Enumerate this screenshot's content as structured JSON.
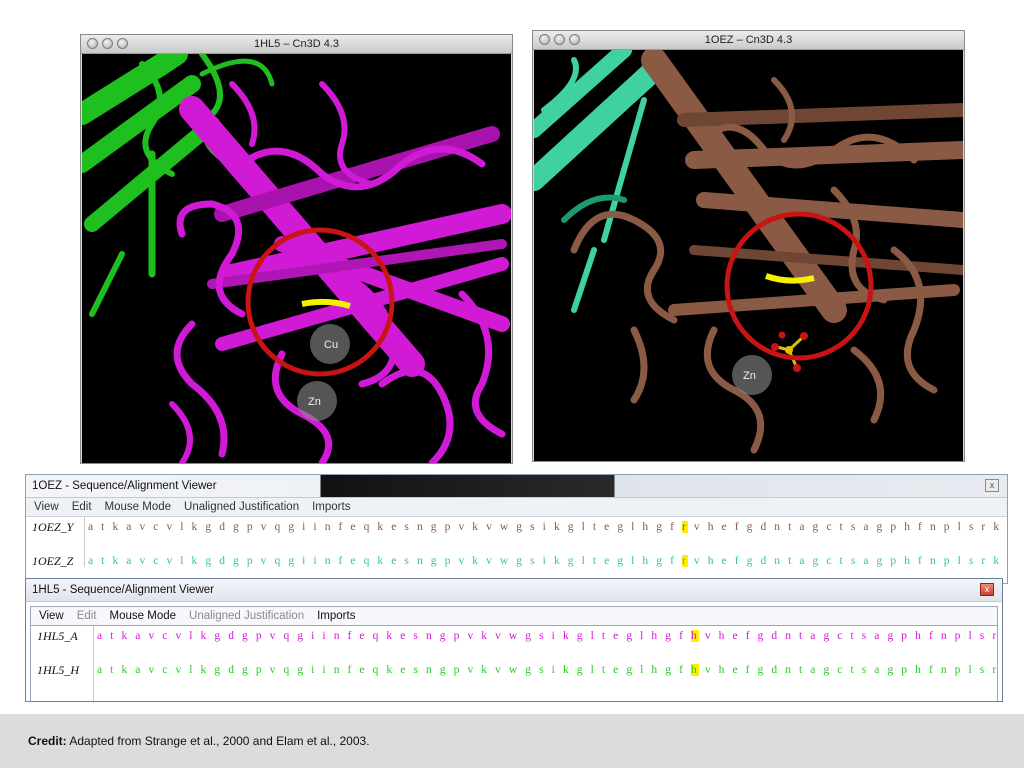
{
  "window_left": {
    "title": "1HL5 – Cn3D 4.3",
    "ion_labels": [
      "Cu",
      "Zn"
    ]
  },
  "window_right": {
    "title": "1OEZ – Cn3D 4.3",
    "ion_labels": [
      "Zn"
    ]
  },
  "viewer_back": {
    "title": "1OEZ - Sequence/Alignment Viewer",
    "menu": [
      "View",
      "Edit",
      "Mouse Mode",
      "Unaligned Justification",
      "Imports"
    ],
    "rows": [
      {
        "label": "1OEZ_Y",
        "pre": "a t k a v c v l k g d g p v q g i i n f e q k e s n g p v k v w g s i k g l t e g l h g f ",
        "hit": "r",
        "post": " v h e f g d n t a g c t s a g p h f n p l s r k h g g p k d e e r h v g d l"
      },
      {
        "label": "1OEZ_Z",
        "pre": "a t k a v c v l k g d g p v q g i i n f e q k e s n g p v k v w g s i k g l t e g l h g f ",
        "hit": "r",
        "post": " v h e f g d n t a g c t s a g p h f n p l s r k h g g p k d e e r h v g d l"
      }
    ]
  },
  "viewer_front": {
    "title": "1HL5 - Sequence/Alignment Viewer",
    "menu": [
      "View",
      "Edit",
      "Mouse Mode",
      "Unaligned Justification",
      "Imports"
    ],
    "rows": [
      {
        "label": "1HL5_A",
        "pre": "a t k a v c v l k g d g p v q g i i n f e q k e s n g p v k v w g s i k g l t e g l h g f ",
        "hit": "h",
        "post": " v h e f g d n t a g c t s a g p h f n p l s r k h g g p k d e e r h v g d l"
      },
      {
        "label": "1HL5_H",
        "pre": "a t k a v c v l k g d g p v q g i i n f e q k e s n g p v k v w g s i k g l t e g l h g f ",
        "hit": "h",
        "post": " v h e f g d n t a g c t s a g p h f n p l s r k h g g p k d e e r h v g d l"
      }
    ]
  },
  "footer": {
    "credit_label": "Credit:",
    "credit_text": "Adapted from Strange et al., 2000 and Elam et al., 2003."
  },
  "colors": {
    "magenta": "#d01ad6",
    "brown": "#8a5a44",
    "green": "#1fbf1f",
    "teal": "#3fd1a0",
    "circle": "#c81414",
    "highlight": "#ffee00"
  }
}
